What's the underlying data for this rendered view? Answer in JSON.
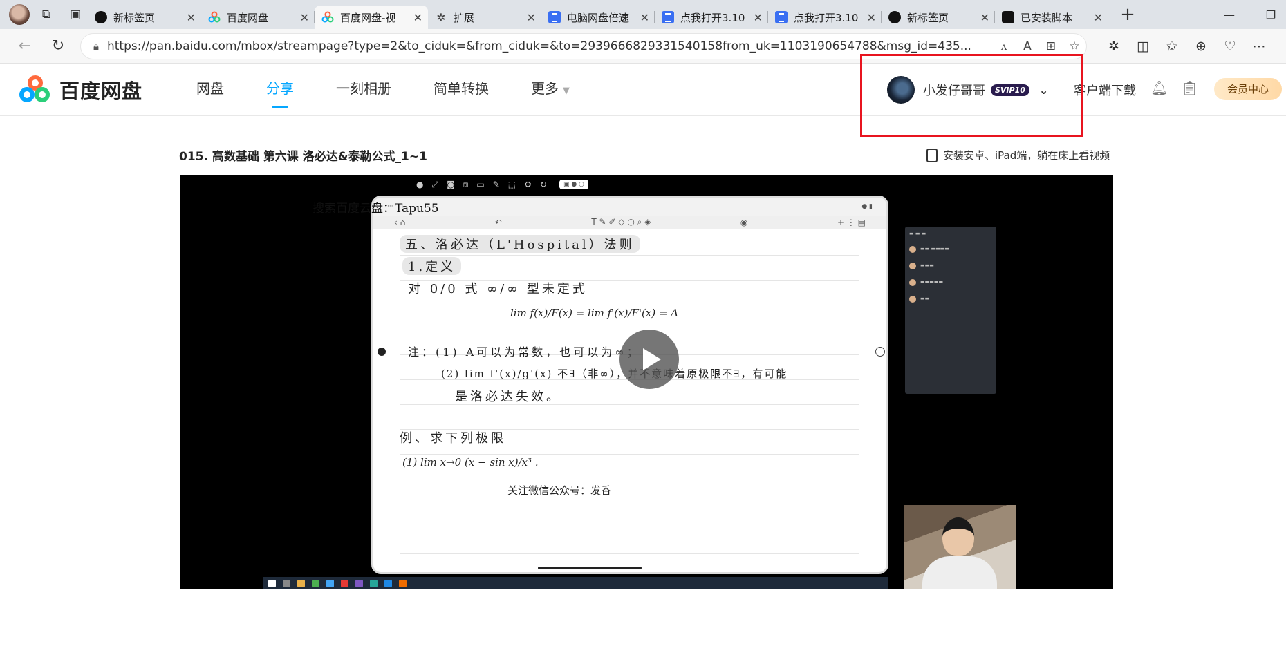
{
  "browser": {
    "tabs": [
      {
        "title": "新标签页",
        "favicon": "github-icon",
        "active": false
      },
      {
        "title": "百度网盘",
        "favicon": "baidu-pan-icon",
        "active": false
      },
      {
        "title": "百度网盘-视",
        "favicon": "baidu-pan-icon",
        "active": true
      },
      {
        "title": "扩展",
        "favicon": "extension-icon",
        "active": false
      },
      {
        "title": "电脑网盘倍速",
        "favicon": "doc-icon",
        "active": false
      },
      {
        "title": "点我打开3.10",
        "favicon": "doc-icon",
        "active": false
      },
      {
        "title": "点我打开3.10",
        "favicon": "doc-icon",
        "active": false
      },
      {
        "title": "新标签页",
        "favicon": "github-icon",
        "active": false
      },
      {
        "title": "已安装脚本",
        "favicon": "tampermonkey-icon",
        "active": false
      }
    ],
    "url": "https://pan.baidu.com/mbox/streampage?type=2&to_ciduk=&from_ciduk=&to=2939666829331540158from_uk=1103190654788&msg_id=435...",
    "url_display_host": "pan.baidu.com"
  },
  "header": {
    "logo_text": "百度网盘",
    "nav": [
      {
        "label": "网盘",
        "active": false
      },
      {
        "label": "分享",
        "active": true
      },
      {
        "label": "一刻相册",
        "active": false
      },
      {
        "label": "简单转换",
        "active": false
      },
      {
        "label": "更多",
        "active": false
      }
    ],
    "username": "小发仔哥哥",
    "vip_badge": "SVIP10",
    "client_download": "客户端下载",
    "vip_center": "会员中心"
  },
  "content": {
    "video_title": "015. 高数基础 第六课 洛必达&泰勒公式_1~1",
    "tablet_tip": "安装安卓、iPad端，躺在床上看视频",
    "watermark_top": "搜索百度云盘：Tapu55",
    "watermark_bottom": "关注微信公众号：发香",
    "note_lines": [
      "五、洛必达（L'Hospital）法则",
      "1.定义",
      "对 0/0 式 ∞/∞ 型未定式",
      "lim f(x)/F(x) = lim f'(x)/F'(x) = A",
      "注：(1) A可以为常数，也可以为∞；",
      "(2) lim f'(x)/g'(x) 不∃（非∞），并不意味着原极限不∃，有可能",
      "是洛必达失效。",
      "例、求下列极限",
      "(1) lim x→0 (x − sin x)/x³ ."
    ]
  },
  "colors": {
    "accent": "#06a7ff",
    "highlight": "#e8141f",
    "vip_badge_bg": "#2a1c4e"
  }
}
